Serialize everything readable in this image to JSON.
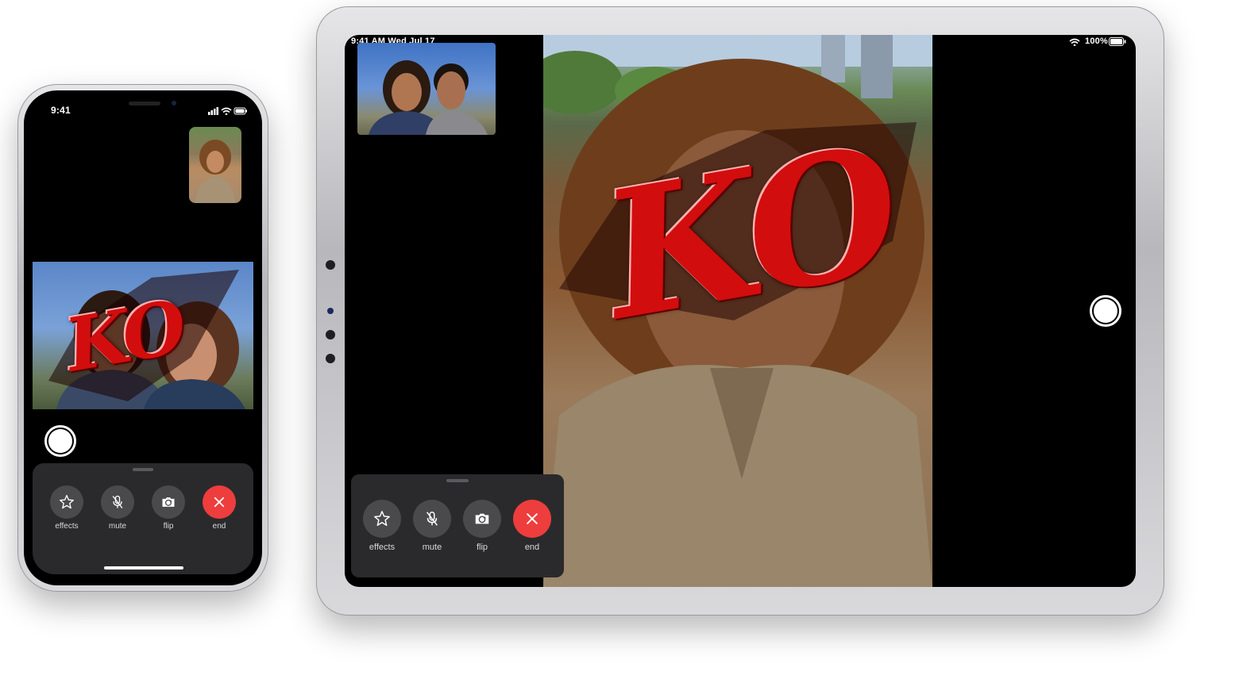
{
  "iphone": {
    "status": {
      "time": "9:41"
    },
    "controls": [
      {
        "id": "effects",
        "label": "effects",
        "icon": "star-icon"
      },
      {
        "id": "mute",
        "label": "mute",
        "icon": "mic-off-icon"
      },
      {
        "id": "flip",
        "label": "flip",
        "icon": "camera-flip-icon"
      },
      {
        "id": "end",
        "label": "end",
        "icon": "close-icon"
      }
    ],
    "sticker": "KO"
  },
  "ipad": {
    "status": {
      "time_date": "9:41 AM   Wed Jul 17",
      "battery": "100%"
    },
    "controls": [
      {
        "id": "effects",
        "label": "effects",
        "icon": "star-icon"
      },
      {
        "id": "mute",
        "label": "mute",
        "icon": "mic-off-icon"
      },
      {
        "id": "flip",
        "label": "flip",
        "icon": "camera-flip-icon"
      },
      {
        "id": "end",
        "label": "end",
        "icon": "close-icon"
      }
    ],
    "sticker": "KO"
  },
  "colors": {
    "end_button": "#ee3d3d",
    "control_button": "#4a4a4d",
    "panel": "#2a2a2c",
    "sticker_red": "#d20d0d"
  }
}
